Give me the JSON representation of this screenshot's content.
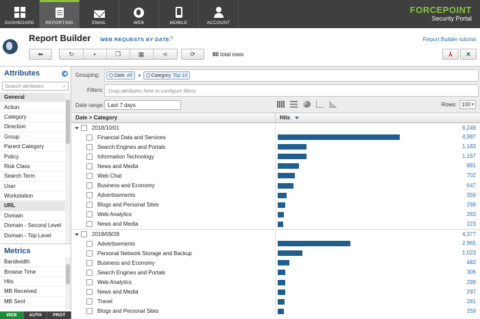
{
  "nav": {
    "items": [
      {
        "label": "DASHBOARD",
        "icon": "dashboard-icon"
      },
      {
        "label": "REPORTING",
        "icon": "report-icon"
      },
      {
        "label": "EMAIL",
        "icon": "email-icon"
      },
      {
        "label": "WEB",
        "icon": "globe-icon"
      },
      {
        "label": "MOBILE",
        "icon": "mobile-icon"
      },
      {
        "label": "ACCOUNT",
        "icon": "account-icon"
      }
    ],
    "brand": "FORCEPOINT",
    "product": "Security Portal",
    "brand_color": "#8ac43f"
  },
  "header": {
    "title": "Report Builder",
    "subtitle": "WEB REQUESTS BY DATE",
    "tutorial_link": "Report Builder tutorial",
    "total_rows": "80",
    "total_rows_label": "total rows"
  },
  "sidebar": {
    "attributes_title": "Attributes",
    "search_placeholder": "Search attributes",
    "attributes": [
      {
        "label": "General",
        "group": true
      },
      {
        "label": "Action"
      },
      {
        "label": "Category"
      },
      {
        "label": "Direction"
      },
      {
        "label": "Group"
      },
      {
        "label": "Parent Category"
      },
      {
        "label": "Policy"
      },
      {
        "label": "Risk Class"
      },
      {
        "label": "Search Term"
      },
      {
        "label": "User"
      },
      {
        "label": "Workstation"
      },
      {
        "label": "URL",
        "group": true
      },
      {
        "label": "Domain"
      },
      {
        "label": "Domain - Second Level"
      },
      {
        "label": "Domain - Top Level"
      }
    ],
    "metrics_title": "Metrics",
    "metrics": [
      "Bandwidth",
      "Browse Time",
      "Hits",
      "MB Received",
      "MB Sent"
    ],
    "tabs": [
      "WEB",
      "AUTH",
      "PROT"
    ]
  },
  "main": {
    "grouping_label": "Grouping:",
    "grouping": [
      {
        "name": "Date",
        "value": "All"
      },
      {
        "name": "Category",
        "value": "Top 10"
      }
    ],
    "filters_label": "Filters:",
    "filters_placeholder": "Drag attributes here to configure filters.",
    "date_range_label": "Date range:",
    "date_range": "Last 7 days",
    "rows_label": "Rows:",
    "rows_value": "100",
    "col_dimension": "Date > Category",
    "col_metric": "Hits",
    "groups": [
      {
        "date": "2018/10/01",
        "total": "6,249",
        "rows": [
          {
            "label": "Financial Data and Services",
            "value": "4,997",
            "n": 4997
          },
          {
            "label": "Search Engines and Portals",
            "value": "1,183",
            "n": 1183
          },
          {
            "label": "Information Technology",
            "value": "1,167",
            "n": 1167
          },
          {
            "label": "News and Media",
            "value": "881",
            "n": 881
          },
          {
            "label": "Web Chat",
            "value": "702",
            "n": 702
          },
          {
            "label": "Business and Economy",
            "value": "647",
            "n": 647
          },
          {
            "label": "Advertisements",
            "value": "356",
            "n": 356
          },
          {
            "label": "Blogs and Personal Sites",
            "value": "299",
            "n": 299
          },
          {
            "label": "Web Analytics",
            "value": "263",
            "n": 263
          },
          {
            "label": "News and Media",
            "value": "223",
            "n": 223
          }
        ]
      },
      {
        "date": "2018/09/28",
        "total": "4,377",
        "rows": [
          {
            "label": "Advertisements",
            "value": "2,965",
            "n": 2965
          },
          {
            "label": "Personal Network Storage and Backup",
            "value": "1,023",
            "n": 1023
          },
          {
            "label": "Business and Economy",
            "value": "483",
            "n": 483
          },
          {
            "label": "Search Engines and Portals",
            "value": "306",
            "n": 306
          },
          {
            "label": "Web Analytics",
            "value": "299",
            "n": 299
          },
          {
            "label": "News and Media",
            "value": "297",
            "n": 297
          },
          {
            "label": "Travel",
            "value": "281",
            "n": 281
          },
          {
            "label": "Blogs and Personal Sites",
            "value": "259",
            "n": 259
          }
        ]
      }
    ],
    "bar_color": "#1f5f8e",
    "bar_max": 4997
  }
}
